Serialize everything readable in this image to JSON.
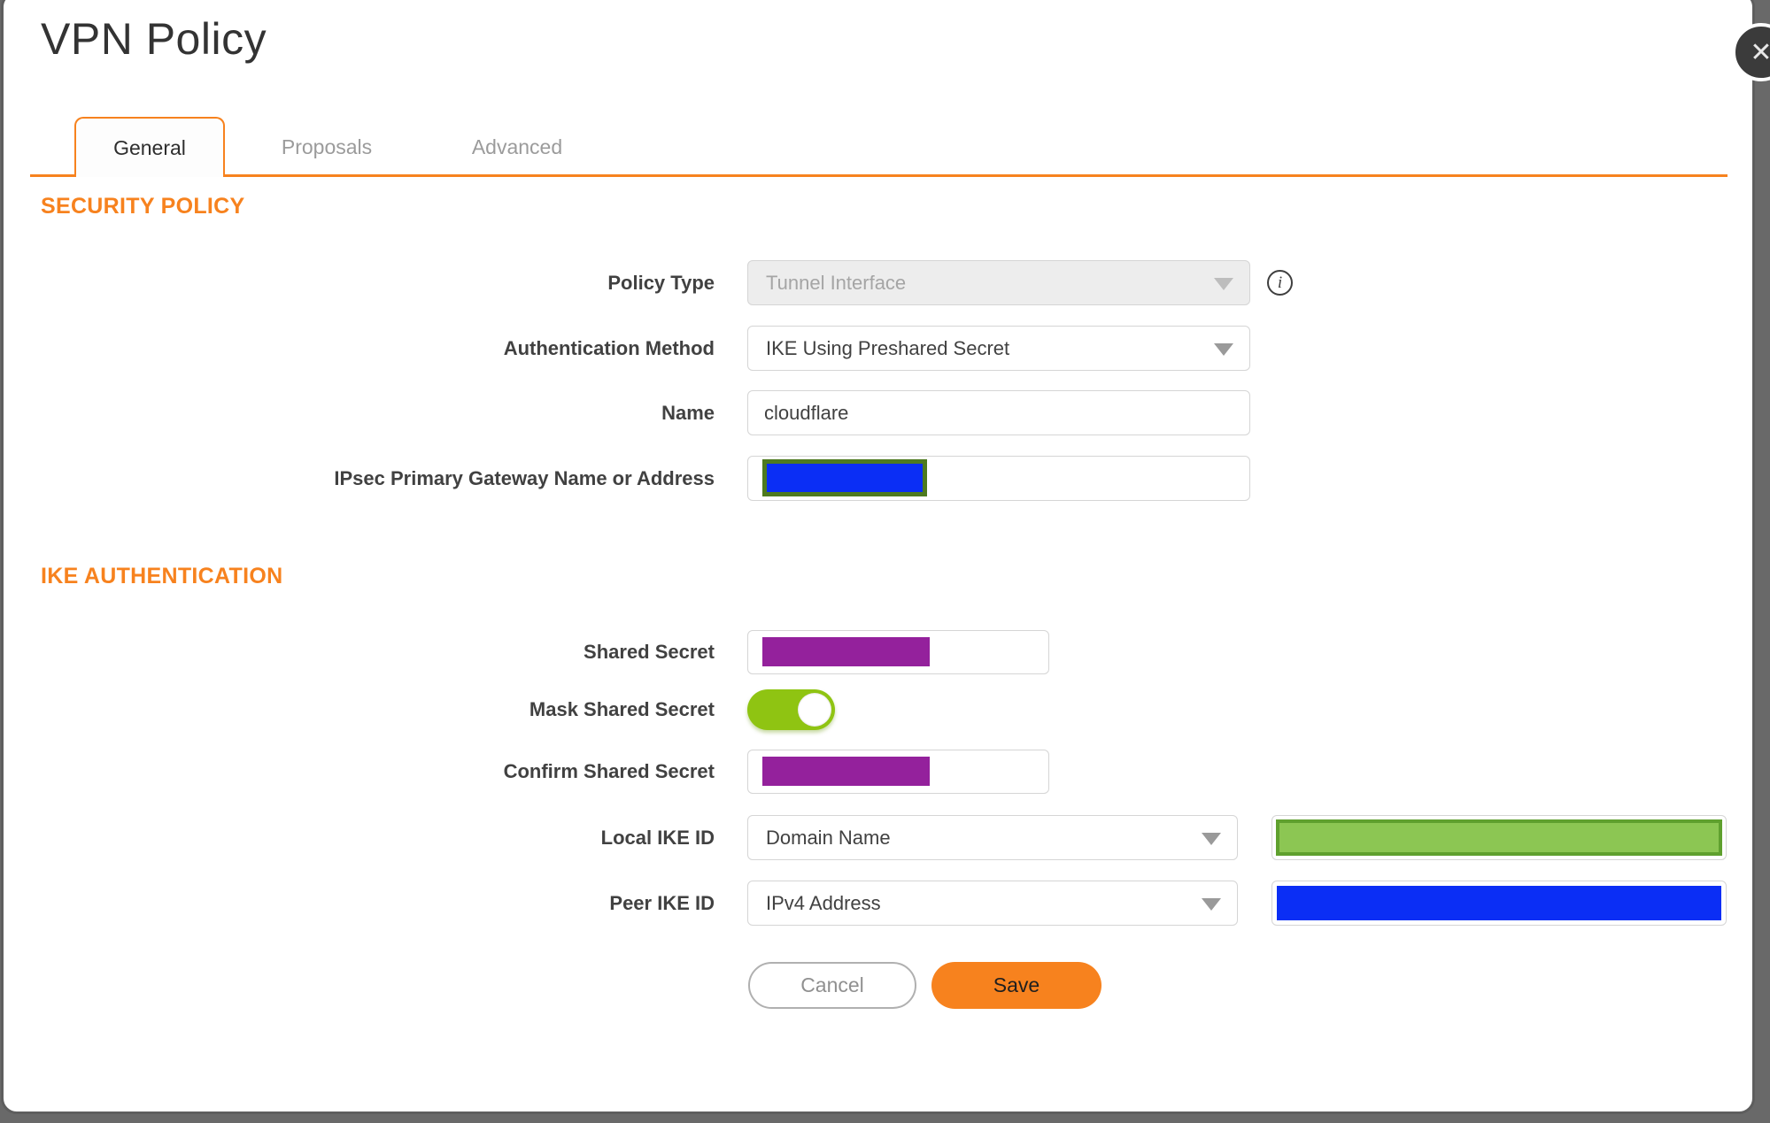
{
  "modal": {
    "title": "VPN Policy"
  },
  "icons": {
    "close_glyph": "✕",
    "info_glyph": "i"
  },
  "tabs": {
    "general": "General",
    "proposals": "Proposals",
    "advanced": "Advanced",
    "active": "General"
  },
  "sections": [
    {
      "heading": "SECURITY POLICY"
    },
    {
      "heading": "IKE AUTHENTICATION"
    }
  ],
  "fields": {
    "policy_type": {
      "label": "Policy Type",
      "value": "Tunnel Interface",
      "disabled": true
    },
    "authentication_method": {
      "label": "Authentication Method",
      "value": "IKE Using Preshared Secret"
    },
    "name": {
      "label": "Name",
      "value": "cloudflare"
    },
    "ipsec_gateway": {
      "label": "IPsec Primary Gateway Name or Address",
      "value": "",
      "redacted": true
    },
    "shared_secret": {
      "label": "Shared Secret",
      "value": "",
      "redacted": true
    },
    "mask_shared_secret": {
      "label": "Mask Shared Secret",
      "state": "on"
    },
    "confirm_shared_secret": {
      "label": "Confirm Shared Secret",
      "value": "",
      "redacted": true
    },
    "local_ike_id": {
      "label": "Local IKE ID",
      "value": "Domain Name",
      "id_value_redacted": true
    },
    "peer_ike_id": {
      "label": "Peer IKE ID",
      "value": "IPv4 Address",
      "id_value_redacted": true
    }
  },
  "buttons": {
    "cancel_label": "Cancel",
    "save_label": "Save"
  },
  "colors": {
    "accent_orange": "#f7821e",
    "backdrop_gray": "#696969",
    "redact_purple": "#94219c",
    "redact_blue": "#0b2ef5",
    "redact_blue_border": "#4e7a1f",
    "redact_green": "#8cc653",
    "redact_green_border": "#5fa02e",
    "toggle_green": "#8fc412"
  }
}
